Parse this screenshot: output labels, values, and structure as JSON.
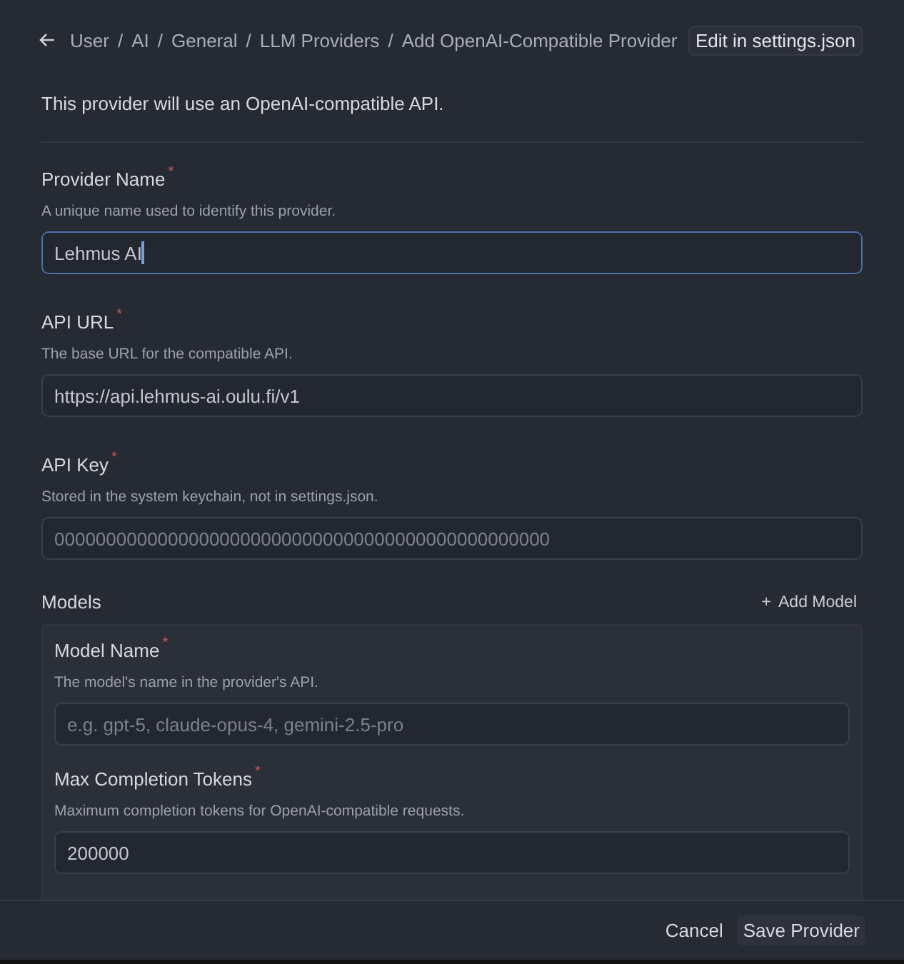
{
  "breadcrumb": {
    "separator": "/",
    "items": [
      {
        "label": "User"
      },
      {
        "label": "AI"
      },
      {
        "label": "General"
      },
      {
        "label": "LLM Providers"
      },
      {
        "label": "Add OpenAI-Compatible Provider"
      }
    ]
  },
  "edit_button": "Edit in settings.json",
  "intro": "This provider will use an OpenAI-compatible API.",
  "fields": [
    {
      "label": "Provider Name",
      "required_mark": "*",
      "description": "A unique name used to identify this provider.",
      "value": "Lehmus AI",
      "focused": true
    },
    {
      "label": "API URL",
      "required_mark": "*",
      "description": "The base URL for the compatible API.",
      "value": "https://api.lehmus-ai.oulu.fi/v1",
      "focused": false
    },
    {
      "label": "API Key",
      "required_mark": "*",
      "description": "Stored in the system keychain, not in settings.json.",
      "placeholder": "000000000000000000000000000000000000000000000000",
      "focused": false
    }
  ],
  "models": {
    "title": "Models",
    "add_button": {
      "icon": "+",
      "label": "Add Model"
    },
    "fields": [
      {
        "label": "Model Name",
        "required_mark": "*",
        "description": "The model's name in the provider's API.",
        "placeholder": "e.g. gpt-5, claude-opus-4, gemini-2.5-pro",
        "focused": false
      },
      {
        "label": "Max Completion Tokens",
        "required_mark": "*",
        "description": "Maximum completion tokens for OpenAI-compatible requests.",
        "value": "200000",
        "focused": false
      }
    ]
  },
  "footer": {
    "cancel": "Cancel",
    "save": "Save Provider"
  }
}
